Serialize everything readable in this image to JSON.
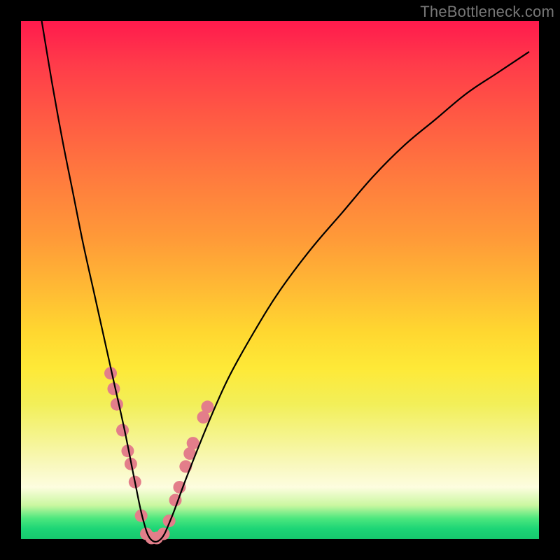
{
  "watermark": "TheBottleneck.com",
  "chart_data": {
    "type": "line",
    "title": "",
    "xlabel": "",
    "ylabel": "",
    "xlim": [
      0,
      100
    ],
    "ylim": [
      0,
      100
    ],
    "background": "vertical-gradient-red-to-green",
    "series": [
      {
        "name": "bottleneck-curve",
        "x": [
          4,
          6,
          8,
          10,
          12,
          14,
          16,
          18,
          20,
          22,
          23.5,
          25,
          27,
          29,
          32,
          36,
          40,
          45,
          50,
          56,
          62,
          68,
          74,
          80,
          86,
          92,
          98
        ],
        "y": [
          100,
          88,
          77,
          67,
          57,
          48,
          39,
          30,
          21,
          11,
          4,
          0,
          0,
          4,
          12,
          22,
          31,
          40,
          48,
          56,
          63,
          70,
          76,
          81,
          86,
          90,
          94
        ]
      }
    ],
    "markers": {
      "name": "sample-points",
      "points": [
        {
          "x": 17.3,
          "y": 32.0
        },
        {
          "x": 17.9,
          "y": 29.0
        },
        {
          "x": 18.5,
          "y": 26.0
        },
        {
          "x": 19.6,
          "y": 21.0
        },
        {
          "x": 20.6,
          "y": 17.0
        },
        {
          "x": 21.2,
          "y": 14.5
        },
        {
          "x": 22.0,
          "y": 11.0
        },
        {
          "x": 23.2,
          "y": 4.5
        },
        {
          "x": 24.2,
          "y": 1.0
        },
        {
          "x": 25.2,
          "y": 0.2
        },
        {
          "x": 26.2,
          "y": 0.2
        },
        {
          "x": 27.5,
          "y": 1.0
        },
        {
          "x": 28.6,
          "y": 3.5
        },
        {
          "x": 29.8,
          "y": 7.5
        },
        {
          "x": 30.6,
          "y": 10.0
        },
        {
          "x": 31.8,
          "y": 14.0
        },
        {
          "x": 32.6,
          "y": 16.5
        },
        {
          "x": 33.2,
          "y": 18.5
        },
        {
          "x": 35.2,
          "y": 23.5
        },
        {
          "x": 36.0,
          "y": 25.5
        }
      ],
      "radius": 9
    }
  }
}
